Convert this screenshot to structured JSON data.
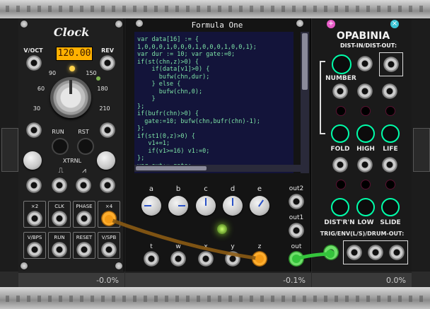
{
  "clock": {
    "title": "Clock",
    "voct_label": "V/OCT",
    "bpm_display": "120.00",
    "rev_label": "REV",
    "dial_ticks": [
      "30",
      "60",
      "90",
      "150",
      "180",
      "210"
    ],
    "run_label": "RUN",
    "rst_label": "RST",
    "xtrnl_label": "XTRNL",
    "buttons": [
      {
        "label": "×2"
      },
      {
        "label": "CLK"
      },
      {
        "label": "PHASE"
      },
      {
        "label": "×4"
      },
      {
        "label": "V/BPS"
      },
      {
        "label": "RUN"
      },
      {
        "label": "RESET"
      },
      {
        "label": "V/SPB"
      }
    ],
    "status": "-0.0%"
  },
  "formula": {
    "title": "Formula One",
    "code": "var data[16] := {\n1,0,0,0,1,0,0,0,1,0,0,0,1,0,0,1};\nvar dur := 10; var gate:=0;\nif(st(chn,z)>0) {\n    if(data[v1]>0) {\n      bufw(chn,dur);\n    } else {\n      bufw(chn,0);\n    }\n};\nif(bufr(chn)>0) {\n  gate:=10; bufw(chn,bufr(chn)-1);\n};\nif(st1(0,z)>0) {\n   v1+=1;\n   if(v1>=16) v1:=0;\n};\nvar out:= gate;",
    "knob_labels": [
      "a",
      "b",
      "c",
      "d",
      "e"
    ],
    "input_labels": [
      "t",
      "w",
      "x",
      "y",
      "z"
    ],
    "outputs": [
      "out2",
      "out1",
      "out"
    ],
    "status": "-0.1%"
  },
  "opabinia": {
    "title": "OPABINIA",
    "subtitle": "DIST-IN/DIST-OUT:",
    "row1": [
      "NUMBER"
    ],
    "row2": [
      "FOLD",
      "HIGH",
      "LIFE"
    ],
    "row3": [
      "DIST'R'N",
      "LOW",
      "SLIDE"
    ],
    "trig_label": "TRIG/ENV(L/S)/DRUM-OUT:",
    "status": "0.0%"
  },
  "colors": {
    "cable_brown": "#8a5a13",
    "cable_green": "#35c43c",
    "accent_orange": "#f39a16"
  }
}
